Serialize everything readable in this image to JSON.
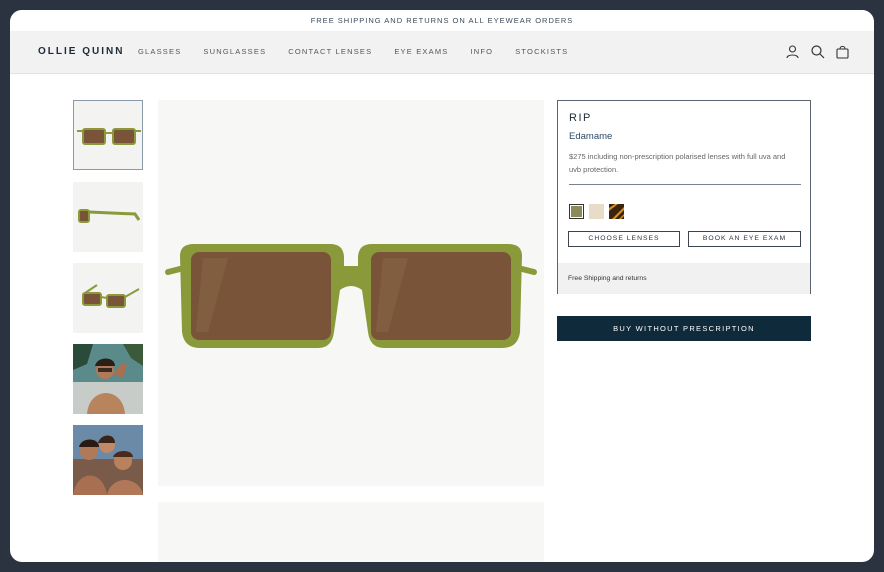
{
  "announcement": "FREE SHIPPING AND RETURNS ON ALL EYEWEAR ORDERS",
  "header": {
    "logo": "OLLIE QUINN",
    "nav": [
      "GLASSES",
      "SUNGLASSES",
      "CONTACT LENSES",
      "EYE EXAMS",
      "INFO",
      "STOCKISTS"
    ],
    "icons": [
      "account-icon",
      "search-icon",
      "cart-icon"
    ]
  },
  "product": {
    "name": "RIP",
    "color": "Edamame",
    "description": "$275 including non-prescription polarised lenses with full uva and uvb protection.",
    "swatches": [
      {
        "name": "edamame",
        "color": "#8a8a5a"
      },
      {
        "name": "cream",
        "color": "#e8dcc8"
      },
      {
        "name": "tortoise",
        "color": "#3a2410"
      }
    ],
    "choose_lenses": "CHOOSE LENSES",
    "book_exam": "BOOK AN EYE EXAM",
    "shipping_note": "Free Shipping and returns",
    "buy_label": "BUY WITHOUT PRESCRIPTION"
  },
  "colors": {
    "frame": "#8a9a3a",
    "lens": "#7a5438",
    "buy_button": "#0f2a3a"
  }
}
